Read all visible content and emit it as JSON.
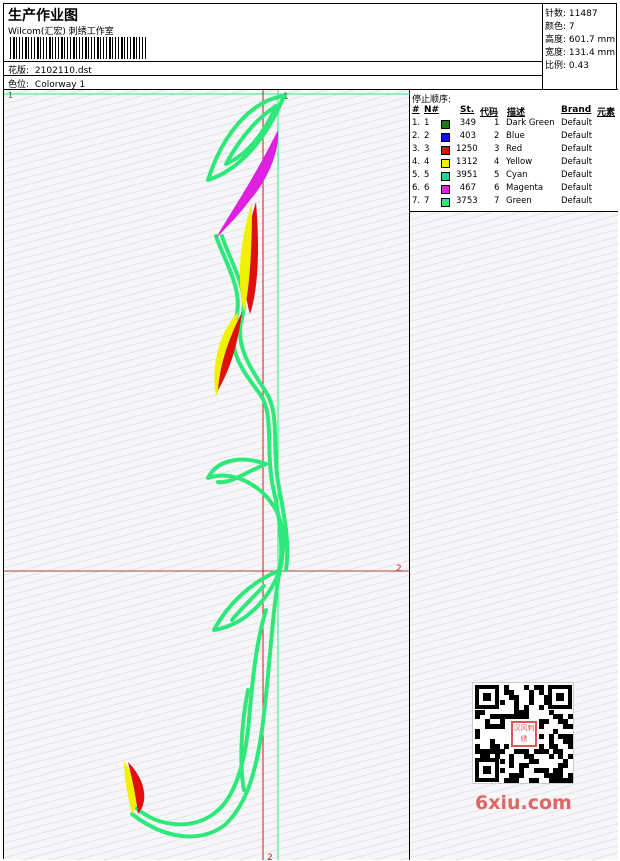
{
  "header": {
    "title": "生产作业图",
    "company": "Wilcom(汇宏) 刺绣工作室",
    "design_label": "花版:",
    "design_value": "2102110.dst",
    "colorway_label": "色位:",
    "colorway_value": "Colorway 1"
  },
  "stats": [
    {
      "label": "针数:",
      "value": "11487"
    },
    {
      "label": "颜色:",
      "value": "7"
    },
    {
      "label": "高度:",
      "value": "601.7 mm"
    },
    {
      "label": "宽度:",
      "value": "131.4 mm"
    },
    {
      "label": "比例:",
      "value": "0.43"
    }
  ],
  "stop_sequence": {
    "title": "停止顺序:",
    "columns": [
      "#",
      "N#",
      "St.",
      "代码",
      "描述",
      "Brand",
      "元素"
    ],
    "rows": [
      {
        "num": "1.",
        "n": "1",
        "st": "349",
        "code": "1",
        "desc": "Dark Green",
        "brand": "Default",
        "color": "#1a7a1a"
      },
      {
        "num": "2.",
        "n": "2",
        "st": "403",
        "code": "2",
        "desc": "Blue",
        "brand": "Default",
        "color": "#1010e0"
      },
      {
        "num": "3.",
        "n": "3",
        "st": "1250",
        "code": "3",
        "desc": "Red",
        "brand": "Default",
        "color": "#e01010"
      },
      {
        "num": "4.",
        "n": "4",
        "st": "1312",
        "code": "4",
        "desc": "Yellow",
        "brand": "Default",
        "color": "#f2f200"
      },
      {
        "num": "5.",
        "n": "5",
        "st": "3951",
        "code": "5",
        "desc": "Cyan",
        "brand": "Default",
        "color": "#22d88a"
      },
      {
        "num": "6.",
        "n": "6",
        "st": "467",
        "code": "6",
        "desc": "Magenta",
        "brand": "Default",
        "color": "#e020e0"
      },
      {
        "num": "7.",
        "n": "7",
        "st": "3753",
        "code": "7",
        "desc": "Green",
        "brand": "Default",
        "color": "#2ee87a"
      }
    ]
  },
  "guides": {
    "marker_1": "1",
    "marker_2": "2"
  },
  "watermark": {
    "site": "6xiu.com",
    "badge": "汉风刺绣"
  }
}
